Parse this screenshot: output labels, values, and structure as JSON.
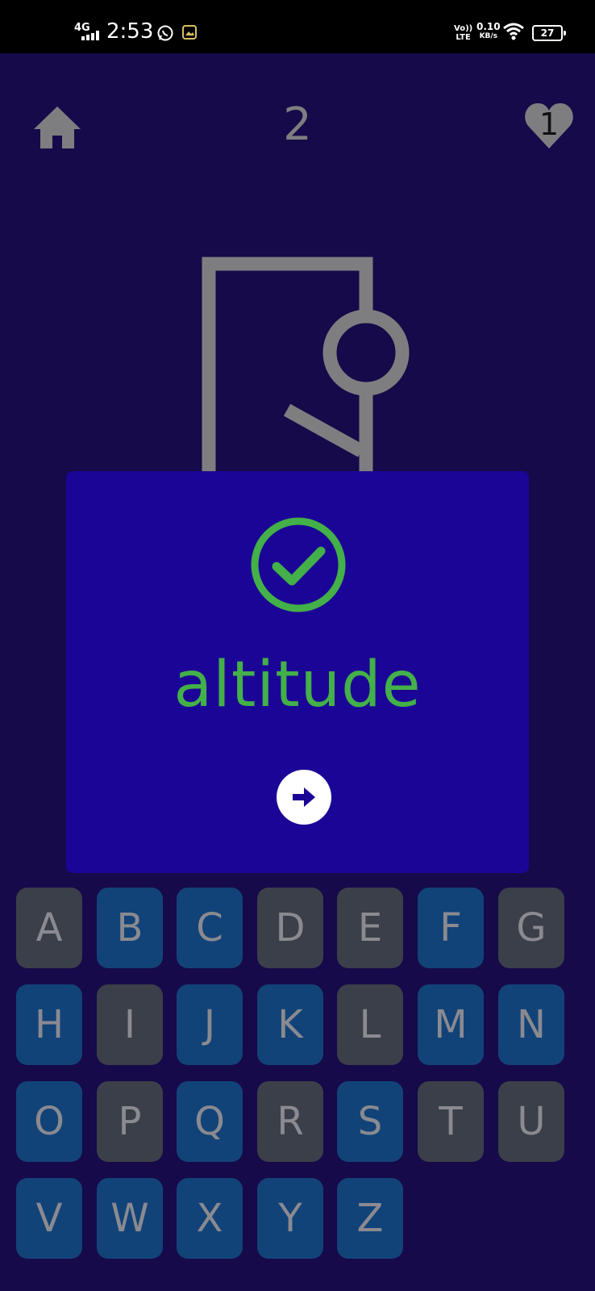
{
  "status_bar": {
    "network": "4G",
    "time": "2:53",
    "volte": "Vo)) LTE",
    "speed_value": "0.10",
    "speed_unit": "KB/s",
    "battery": "27"
  },
  "header": {
    "level": "2",
    "lives": "1"
  },
  "result": {
    "word": "altitude",
    "status_icon": "check-circle-icon",
    "next_icon": "arrow-right-icon"
  },
  "colors": {
    "background": "#160a4a",
    "panel": "#1b0596",
    "success": "#43b049",
    "key_used": "#3b3f49",
    "key_available": "#124378"
  },
  "keyboard": {
    "keys": [
      {
        "letter": "A",
        "state": "used"
      },
      {
        "letter": "B",
        "state": "available"
      },
      {
        "letter": "C",
        "state": "available"
      },
      {
        "letter": "D",
        "state": "used"
      },
      {
        "letter": "E",
        "state": "used"
      },
      {
        "letter": "F",
        "state": "available"
      },
      {
        "letter": "G",
        "state": "used"
      },
      {
        "letter": "H",
        "state": "available"
      },
      {
        "letter": "I",
        "state": "used"
      },
      {
        "letter": "J",
        "state": "available"
      },
      {
        "letter": "K",
        "state": "available"
      },
      {
        "letter": "L",
        "state": "used"
      },
      {
        "letter": "M",
        "state": "available"
      },
      {
        "letter": "N",
        "state": "available"
      },
      {
        "letter": "O",
        "state": "available"
      },
      {
        "letter": "P",
        "state": "used"
      },
      {
        "letter": "Q",
        "state": "available"
      },
      {
        "letter": "R",
        "state": "used"
      },
      {
        "letter": "S",
        "state": "available"
      },
      {
        "letter": "T",
        "state": "used"
      },
      {
        "letter": "U",
        "state": "used"
      },
      {
        "letter": "V",
        "state": "available"
      },
      {
        "letter": "W",
        "state": "available"
      },
      {
        "letter": "X",
        "state": "available"
      },
      {
        "letter": "Y",
        "state": "available"
      },
      {
        "letter": "Z",
        "state": "available"
      }
    ]
  }
}
